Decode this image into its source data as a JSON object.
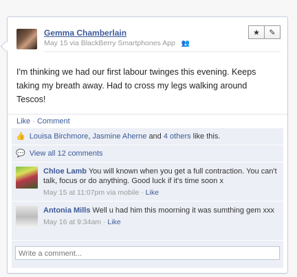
{
  "post": {
    "author": "Gemma Chamberlain",
    "date": "May 15",
    "via": "via BlackBerry Smartphones App",
    "text": "I'm thinking we had our first labour twinges this evening. Keeps taking my breath away. Had to cross my legs walking around Tescos!"
  },
  "actions": {
    "star": "★",
    "edit": "✎"
  },
  "feedback": {
    "like": "Like",
    "dot": "·",
    "comment": "Comment"
  },
  "likes": {
    "user1": "Louisa Birchmore",
    "comma": ",",
    "user2": "Jasmine Aherne",
    "and": "and",
    "others": "4 others",
    "suffix": "like this."
  },
  "view_all": "View all 12 comments",
  "comments": [
    {
      "name": "Chloe Lamb",
      "text": "You will known when you get a full contraction. You can't talk, focus or do anything. Good luck if it's time soon x",
      "time": "May 15 at 11:07pm via mobile",
      "dot": "·",
      "like": "Like"
    },
    {
      "name": "Antonia Mills",
      "text": "Well u had him this moorning it was sumthing gem xxx",
      "time": "May 16 at 9:34am",
      "dot": "·",
      "like": "Like"
    }
  ],
  "write_placeholder": "Write a comment..."
}
